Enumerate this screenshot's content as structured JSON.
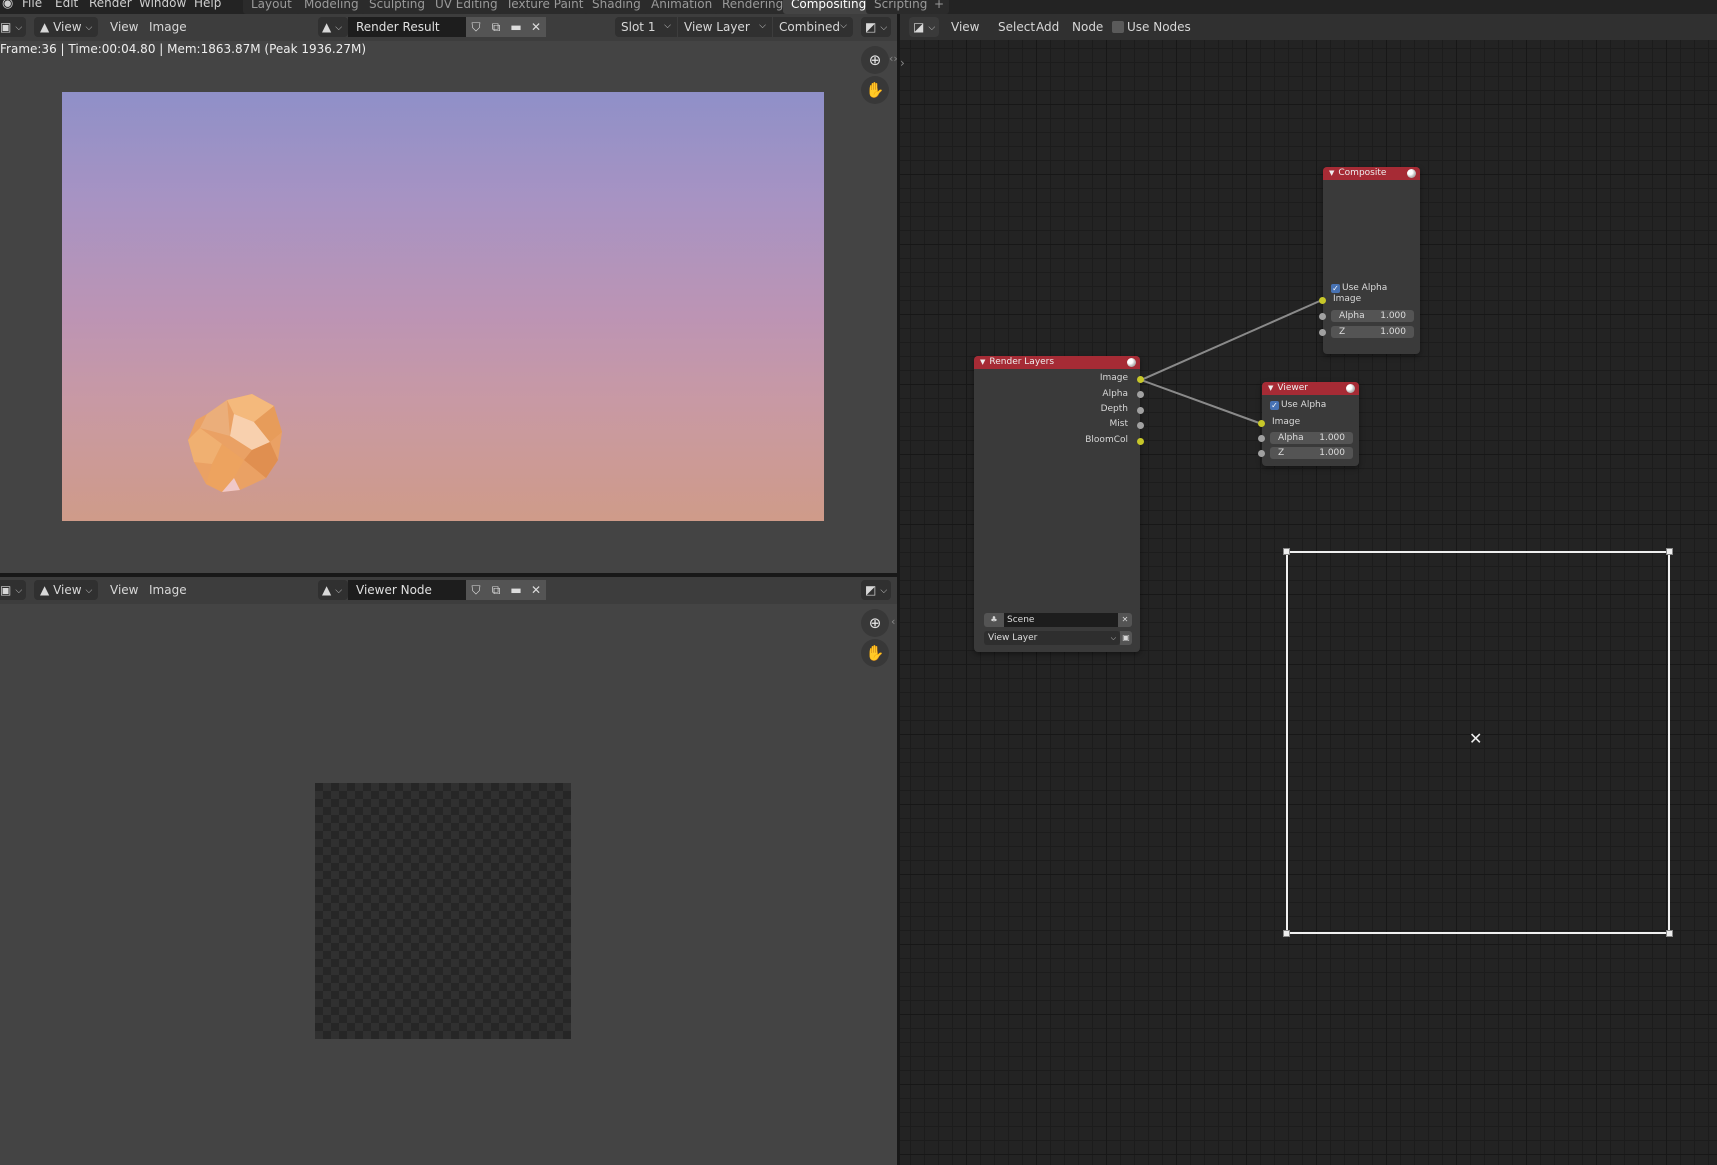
{
  "topbar": {
    "menus": [
      "File",
      "Edit",
      "Render",
      "Window",
      "Help"
    ],
    "workspaces": [
      {
        "label": "Layout",
        "active": false
      },
      {
        "label": "Modeling",
        "active": false
      },
      {
        "label": "Sculpting",
        "active": false
      },
      {
        "label": "UV Editing",
        "active": false
      },
      {
        "label": "Texture Paint",
        "active": false
      },
      {
        "label": "Shading",
        "active": false
      },
      {
        "label": "Animation",
        "active": false
      },
      {
        "label": "Rendering",
        "active": false
      },
      {
        "label": "Compositing",
        "active": true
      },
      {
        "label": "Scripting",
        "active": false
      }
    ],
    "add_workspace": "+"
  },
  "image_editor_top": {
    "view_dropdown": "View",
    "menus": [
      "View",
      "Image"
    ],
    "image_name": "Render Result",
    "slot": "Slot 1",
    "view_layer": "View Layer",
    "pass": "Combined",
    "status": "Frame:36 | Time:00:04.80 | Mem:1863.87M (Peak 1936.27M)"
  },
  "image_editor_bottom": {
    "view_dropdown": "View",
    "menus": [
      "View",
      "Image"
    ],
    "image_name": "Viewer Node"
  },
  "node_editor": {
    "menus": [
      "View",
      "Select",
      "Add",
      "Node"
    ],
    "use_nodes_label": "Use Nodes",
    "use_nodes_checked": false,
    "nodes": {
      "render_layers": {
        "title": "Render Layers",
        "outputs": [
          "Image",
          "Alpha",
          "Depth",
          "Mist",
          "BloomCol"
        ],
        "scene": "Scene",
        "view_layer": "View Layer"
      },
      "composite": {
        "title": "Composite",
        "use_alpha_label": "Use Alpha",
        "use_alpha": true,
        "input_label": "Image",
        "fields": [
          {
            "label": "Alpha",
            "value": "1.000"
          },
          {
            "label": "Z",
            "value": "1.000"
          }
        ]
      },
      "viewer": {
        "title": "Viewer",
        "use_alpha_label": "Use Alpha",
        "use_alpha": true,
        "input_label": "Image",
        "fields": [
          {
            "label": "Alpha",
            "value": "1.000"
          },
          {
            "label": "Z",
            "value": "1.000"
          }
        ]
      }
    },
    "colors": {
      "node_header": "#a62b35",
      "image_socket": "#c7c729",
      "value_socket": "#a1a1a1",
      "link": "#8a8a8a",
      "backdrop_frame": "#ffffff"
    }
  },
  "render_preview": {
    "sky_top": "#8f90c8",
    "sky_mid": "#c196b1",
    "sky_bottom": "#cf9b86",
    "object_color": "#eda865"
  }
}
